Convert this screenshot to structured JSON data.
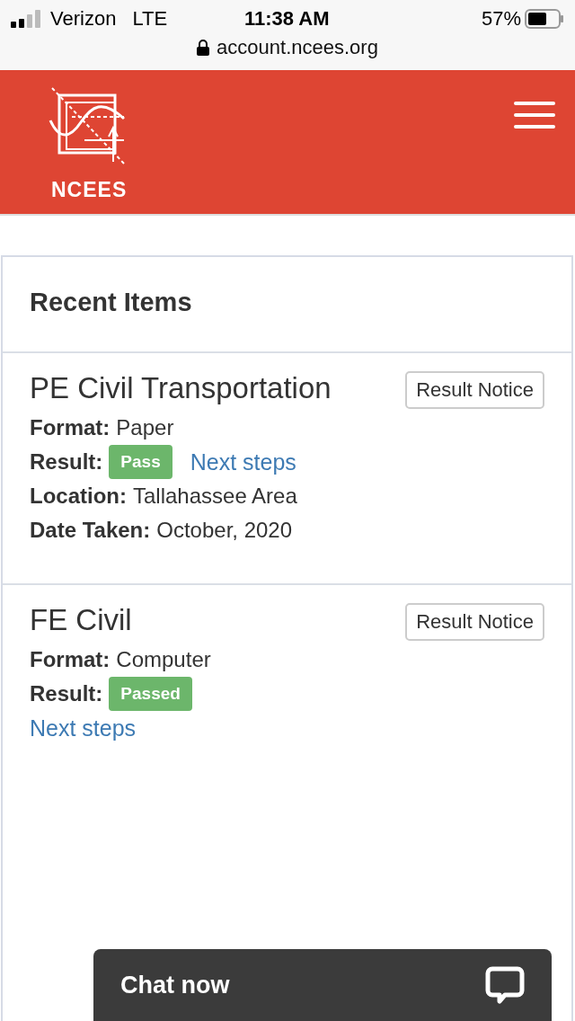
{
  "status_bar": {
    "carrier": "Verizon",
    "network": "LTE",
    "time": "11:38 AM",
    "battery": "57%",
    "url": "account.ncees.org"
  },
  "header": {
    "logo_text": "NCEES"
  },
  "card": {
    "title": "Recent Items",
    "items": [
      {
        "title": "PE Civil Transportation",
        "button": "Result Notice",
        "fields": [
          {
            "kind": "text",
            "label": "Format:",
            "value": "Paper"
          },
          {
            "kind": "result",
            "label": "Result:",
            "badge": "Pass",
            "link": "Next steps"
          },
          {
            "kind": "text",
            "label": "Location:",
            "value": "Tallahassee Area"
          },
          {
            "kind": "text",
            "label": "Date Taken:",
            "value": "October, 2020"
          }
        ]
      },
      {
        "title": "FE Civil",
        "button": "Result Notice",
        "fields": [
          {
            "kind": "text",
            "label": "Format:",
            "value": "Computer"
          },
          {
            "kind": "result_stacked",
            "label": "Result:",
            "badge": "Passed",
            "link": "Next steps"
          }
        ]
      }
    ]
  },
  "chat": {
    "label": "Chat now"
  }
}
